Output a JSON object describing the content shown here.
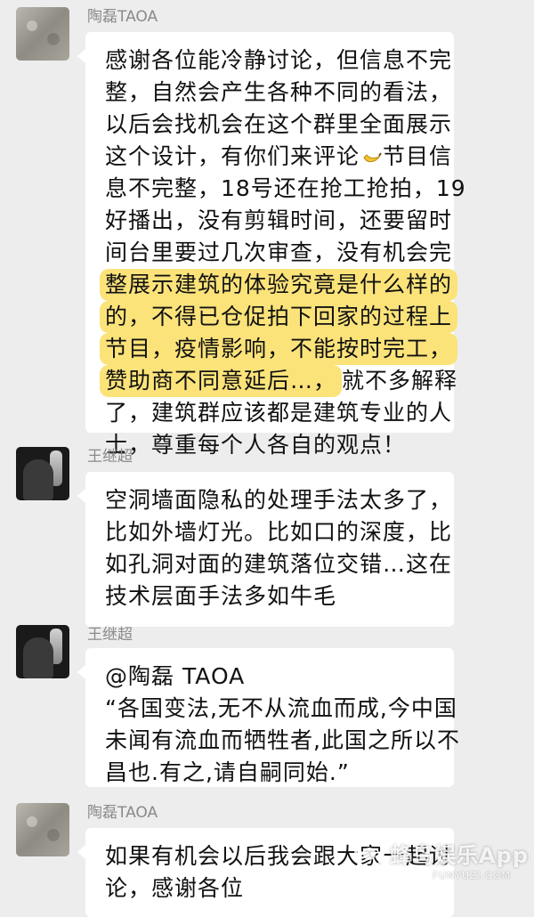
{
  "messages": [
    {
      "sender": "陶磊TAOA",
      "avatar": "stone-avatar",
      "lines": [
        {
          "text": "感谢各位能冷静讨论，但信息不完"
        },
        {
          "text": "整，自然会产生各种不同的看法，"
        },
        {
          "text": "以后会找机会在这个群里全面展示"
        },
        {
          "text": "这个设计，有你们来评论",
          "emoji": "banana-icon",
          "after": "节目信"
        },
        {
          "text": "息不完整，18号还在抢工抢拍，19"
        },
        {
          "text": "好播出，没有剪辑时间，还要留时"
        },
        {
          "text": "间台里要过几次审查，没有机会完"
        },
        {
          "text": "整展示建筑的体验究竟是什么样的",
          "highlight": true
        },
        {
          "text": "的，不得已仓促拍下回家的过程上",
          "highlight": true
        },
        {
          "text": "节目，疫情影响，不能按时完工，",
          "highlight": true
        },
        {
          "text": "赞助商不同意延后…，",
          "highlight": true,
          "after": "就不多解释"
        },
        {
          "text": "了，建筑群应该都是建筑专业的人"
        },
        {
          "text": "士，尊重每个人各自的观点！"
        }
      ]
    },
    {
      "sender": "王继超",
      "avatar": "dark-avatar",
      "lines": [
        {
          "text": "空洞墙面隐私的处理手法太多了，"
        },
        {
          "text": "比如外墙灯光。比如口的深度，比"
        },
        {
          "text": "如孔洞对面的建筑落位交错…这在"
        },
        {
          "text": "技术层面手法多如牛毛"
        }
      ]
    },
    {
      "sender": "王继超",
      "avatar": "dark-avatar",
      "lines": [
        {
          "text": "@陶磊 TAOA"
        },
        {
          "text": "“各国变法,无不从流血而成,今中国"
        },
        {
          "text": "未闻有流血而牺牲者,此国之所以不"
        },
        {
          "text": "昌也.有之,请自嗣同始.”"
        }
      ]
    },
    {
      "sender": "陶磊TAOA",
      "avatar": "stone-avatar",
      "lines": [
        {
          "text": "如果有机会以后我会跟大家一起讨"
        },
        {
          "text": "论，感谢各位"
        }
      ]
    }
  ],
  "watermark": {
    "text": "蜂鸟娱乐App",
    "url": "FUNYUZI.COM"
  },
  "colors": {
    "background": "#ededed",
    "bubble": "#ffffff",
    "highlight": "#fbe37a",
    "name": "#8a8a8a"
  }
}
